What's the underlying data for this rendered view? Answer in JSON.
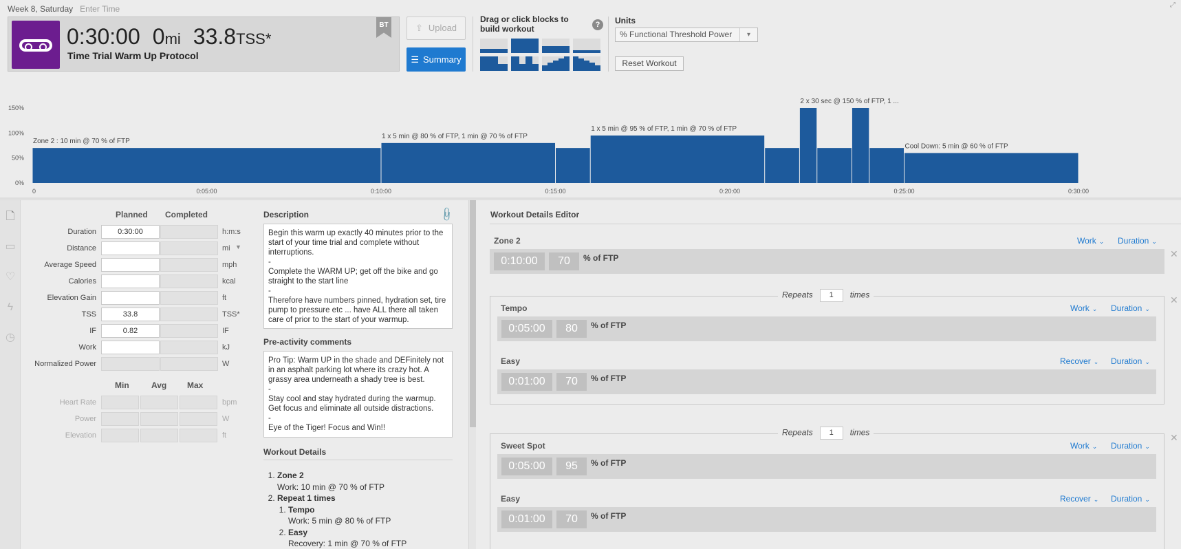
{
  "header": {
    "date": "Week 8, Saturday",
    "enter_time": "Enter Time",
    "duration": "0:30:00",
    "distance_value": "0",
    "distance_unit": "mi",
    "tss_value": "33.8",
    "tss_unit": "TSS*",
    "title": "Time Trial Warm Up Protocol",
    "badge": "BT",
    "accent_color": "#6c1d8f"
  },
  "toolbar": {
    "upload_label": "Upload",
    "summary_label": "Summary",
    "blocks_label": "Drag or click blocks to build workout",
    "help": "?",
    "units_label": "Units",
    "units_value": "% Functional Threshold Power",
    "reset_label": "Reset Workout"
  },
  "chart_data": {
    "type": "bar",
    "x_unit": "minutes",
    "y_unit": "% of FTP",
    "ylim": [
      0,
      150
    ],
    "y_ticks": [
      "0%",
      "50%",
      "100%",
      "150%"
    ],
    "x_ticks": [
      "0",
      "0:05:00",
      "0:10:00",
      "0:15:00",
      "0:20:00",
      "0:25:00",
      "0:30:00"
    ],
    "segments": [
      {
        "start": 0,
        "end": 10,
        "value": 70
      },
      {
        "start": 10,
        "end": 15,
        "value": 80
      },
      {
        "start": 15,
        "end": 16,
        "value": 70
      },
      {
        "start": 16,
        "end": 21,
        "value": 95
      },
      {
        "start": 21,
        "end": 22,
        "value": 70
      },
      {
        "start": 22,
        "end": 22.5,
        "value": 150
      },
      {
        "start": 22.5,
        "end": 23.5,
        "value": 70
      },
      {
        "start": 23.5,
        "end": 24,
        "value": 150
      },
      {
        "start": 24,
        "end": 25,
        "value": 70
      },
      {
        "start": 25,
        "end": 30,
        "value": 60
      }
    ],
    "annotations": [
      {
        "at": 0,
        "value": 70,
        "text": "Zone 2 : 10 min @ 70 % of FTP"
      },
      {
        "at": 10,
        "value": 80,
        "text": "1 x 5 min @ 80 % of FTP, 1 min @ 70 % of FTP"
      },
      {
        "at": 16,
        "value": 95,
        "text": "1 x 5 min @ 95 % of FTP, 1 min @ 70 % of FTP"
      },
      {
        "at": 22,
        "value": 150,
        "text": "2 x 30 sec @ 150 % of FTP, 1 ..."
      },
      {
        "at": 25,
        "value": 60,
        "text": "Cool Down: 5 min @ 60 % of FTP"
      }
    ],
    "bar_color": "#1d5a9c"
  },
  "metrics": {
    "col_planned": "Planned",
    "col_completed": "Completed",
    "rows": [
      {
        "label": "Duration",
        "planned": "0:30:00",
        "unit": "h:m:s"
      },
      {
        "label": "Distance",
        "planned": "",
        "unit": "mi"
      },
      {
        "label": "Average Speed",
        "planned": "",
        "unit": "mph"
      },
      {
        "label": "Calories",
        "planned": "",
        "unit": "kcal"
      },
      {
        "label": "Elevation Gain",
        "planned": "",
        "unit": "ft"
      },
      {
        "label": "TSS",
        "planned": "33.8",
        "unit": "TSS*"
      },
      {
        "label": "IF",
        "planned": "0.82",
        "unit": "IF"
      },
      {
        "label": "Work",
        "planned": "",
        "unit": "kJ"
      },
      {
        "label": "Normalized Power",
        "planned": "",
        "unit": "W"
      }
    ],
    "col_min": "Min",
    "col_avg": "Avg",
    "col_max": "Max",
    "range_rows": [
      {
        "label": "Heart Rate",
        "unit": "bpm"
      },
      {
        "label": "Power",
        "unit": "W"
      },
      {
        "label": "Elevation",
        "unit": "ft"
      }
    ]
  },
  "description": {
    "title": "Description",
    "text": "Begin this warm up exactly 40 minutes prior to the start of your time trial and complete without interruptions.\n-\nComplete the WARM UP; get off the bike and go straight to the start line\n-\nTherefore have numbers pinned, hydration set, tire pump to pressure etc ... have ALL there all taken care of prior to the start of your warmup."
  },
  "comments": {
    "title": "Pre-activity comments",
    "text": "Pro Tip: Warm UP in the shade and DEFinitely not in an asphalt parking lot where its crazy hot. A grassy area underneath a shady tree is best.\n-\nStay cool and stay hydrated during the warmup. Get focus and eliminate all outside distractions.\n-\nEye of the Tiger! Focus and Win!!"
  },
  "workout_details": {
    "title": "Workout Details",
    "item1_name": "Zone 2",
    "item1_detail": "Work: 10 min @ 70 % of FTP",
    "item2_name": "Repeat 1 times",
    "sub1_name": "Tempo",
    "sub1_detail": "Work: 5 min @ 80 % of FTP",
    "sub2_name": "Easy",
    "sub2_detail": "Recovery: 1 min @ 70 % of FTP"
  },
  "editor": {
    "title": "Workout Details Editor",
    "repeats_label": "Repeats",
    "times_label": "times",
    "ftp_label": "% of FTP",
    "zone2": {
      "name": "Zone 2",
      "type": "Work",
      "mode": "Duration",
      "time": "0:10:00",
      "pct": "70"
    },
    "group1": {
      "repeats": "1",
      "steps": [
        {
          "name": "Tempo",
          "type": "Work",
          "mode": "Duration",
          "time": "0:05:00",
          "pct": "80"
        },
        {
          "name": "Easy",
          "type": "Recover",
          "mode": "Duration",
          "time": "0:01:00",
          "pct": "70"
        }
      ]
    },
    "group2": {
      "repeats": "1",
      "steps": [
        {
          "name": "Sweet Spot",
          "type": "Work",
          "mode": "Duration",
          "time": "0:05:00",
          "pct": "95"
        },
        {
          "name": "Easy",
          "type": "Recover",
          "mode": "Duration",
          "time": "0:01:00",
          "pct": "70"
        }
      ]
    }
  }
}
